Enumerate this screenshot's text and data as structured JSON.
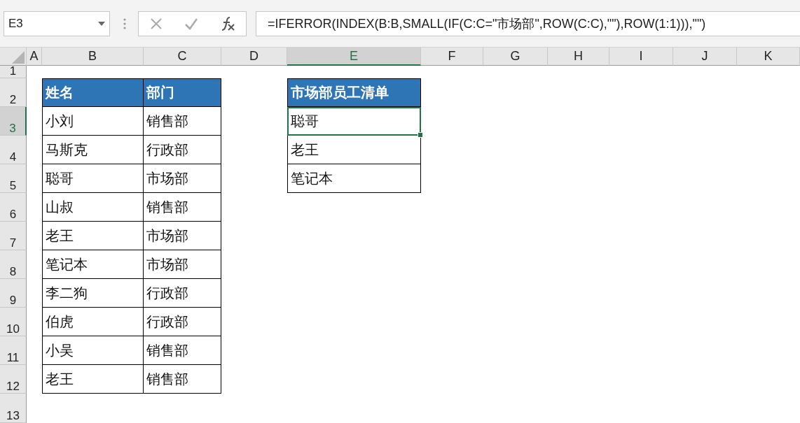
{
  "formula_bar": {
    "name_box": "E3",
    "formula": "=IFERROR(INDEX(B:B,SMALL(IF(C:C=\"市场部\",ROW(C:C),\"\"),ROW(1:1))),\"\")"
  },
  "column_headers": [
    {
      "label": "A",
      "selected": false
    },
    {
      "label": "B",
      "selected": false
    },
    {
      "label": "C",
      "selected": false
    },
    {
      "label": "D",
      "selected": false
    },
    {
      "label": "E",
      "selected": true
    },
    {
      "label": "F",
      "selected": false
    },
    {
      "label": "G",
      "selected": false
    },
    {
      "label": "H",
      "selected": false
    },
    {
      "label": "I",
      "selected": false
    },
    {
      "label": "J",
      "selected": false
    },
    {
      "label": "K",
      "selected": false
    }
  ],
  "row_headers": [
    {
      "label": "1",
      "selected": false
    },
    {
      "label": "2",
      "selected": false
    },
    {
      "label": "3",
      "selected": true
    },
    {
      "label": "4",
      "selected": false
    },
    {
      "label": "5",
      "selected": false
    },
    {
      "label": "6",
      "selected": false
    },
    {
      "label": "7",
      "selected": false
    },
    {
      "label": "8",
      "selected": false
    },
    {
      "label": "9",
      "selected": false
    },
    {
      "label": "10",
      "selected": false
    },
    {
      "label": "11",
      "selected": false
    },
    {
      "label": "12",
      "selected": false
    },
    {
      "label": "13",
      "selected": false
    }
  ],
  "staff_table": {
    "columns": [
      "姓名",
      "部门"
    ],
    "rows": [
      [
        "小刘",
        "销售部"
      ],
      [
        "马斯克",
        "行政部"
      ],
      [
        "聪哥",
        "市场部"
      ],
      [
        "山叔",
        "销售部"
      ],
      [
        "老王",
        "市场部"
      ],
      [
        "笔记本",
        "市场部"
      ],
      [
        "李二狗",
        "行政部"
      ],
      [
        "伯虎",
        "行政部"
      ],
      [
        "小吴",
        "销售部"
      ],
      [
        "老王",
        "销售部"
      ]
    ]
  },
  "result_table": {
    "header": "市场部员工清单",
    "cells": [
      {
        "value": "聪哥",
        "selected": true
      },
      {
        "value": "老王",
        "selected": false
      },
      {
        "value": "笔记本",
        "selected": false
      }
    ]
  }
}
